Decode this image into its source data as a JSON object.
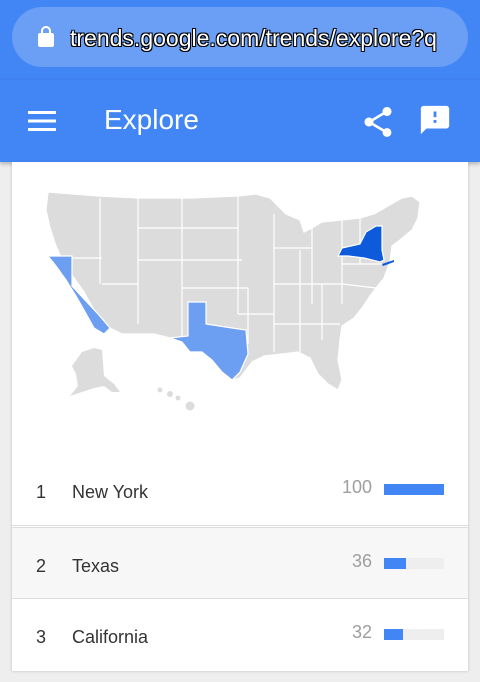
{
  "browser": {
    "url": "trends.google.com/trends/explore?q",
    "lock_icon": "lock-icon"
  },
  "app_bar": {
    "title": "Explore",
    "menu_icon": "hamburger-menu-icon",
    "share_icon": "share-icon",
    "feedback_icon": "feedback-icon"
  },
  "colors": {
    "app_blue": "#4285f4",
    "map_dark": "#0d5bdb",
    "map_light": "#6c9ff2",
    "map_grey": "#dcdcdc"
  },
  "map": {
    "highlighted": [
      {
        "state": "New York",
        "intensity": "high"
      },
      {
        "state": "Texas",
        "intensity": "low"
      },
      {
        "state": "California",
        "intensity": "low"
      }
    ]
  },
  "regions": [
    {
      "rank": "1",
      "name": "New York",
      "value": "100",
      "pct": 1.0
    },
    {
      "rank": "2",
      "name": "Texas",
      "value": "36",
      "pct": 0.36
    },
    {
      "rank": "3",
      "name": "California",
      "value": "32",
      "pct": 0.32
    }
  ]
}
